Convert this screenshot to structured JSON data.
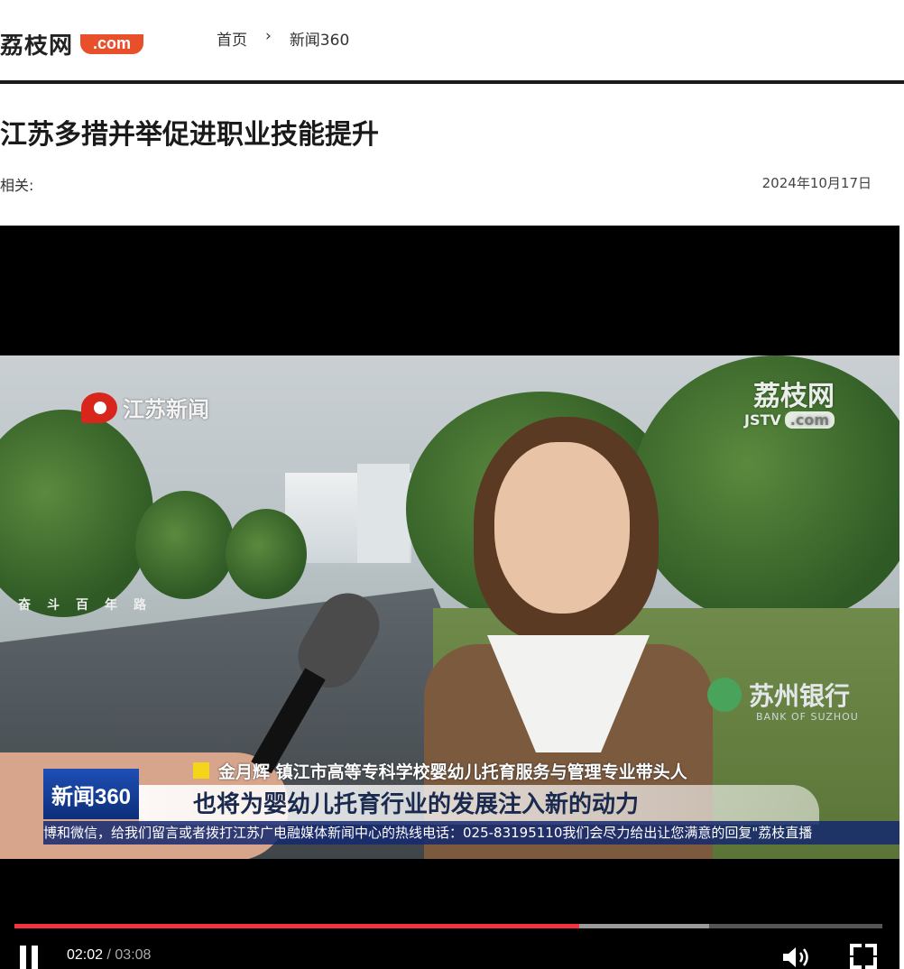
{
  "header": {
    "logo_text": "荔枝网",
    "logo_badge": ".com",
    "breadcrumb": [
      "首页",
      "›",
      "新闻360"
    ]
  },
  "article": {
    "title": "江苏多措并举促进职业技能提升",
    "related_label": "相关:",
    "date": "2024年10月17日"
  },
  "video": {
    "station_logo": "江苏新闻",
    "road_sign": "奋斗百年路",
    "watermark": {
      "main": "荔枝网",
      "sub": "JSTV",
      "badge": ".com"
    },
    "sponsor": {
      "cn": "苏州银行",
      "en": "BANK OF SUZHOU"
    },
    "program_logo": "新闻360",
    "speaker_caption": "金月辉 镇江市高等专科学校婴幼儿托育服务与管理专业带头人",
    "quote": "也将为婴幼儿托育行业的发展注入新的动力",
    "ticker": "博和微信，给我们留言或者拨打江苏广电融媒体新闻中心的热线电话：025-83195110我们会尽力给出让您满意的回复\"荔枝直播",
    "progress": {
      "played_fraction": 0.6509,
      "buffered_fraction": 0.8,
      "current": "02:02",
      "separator": " / ",
      "total": "03:08"
    },
    "colors": {
      "progress_played": "#f4323f",
      "progress_buffer": "#9a9a9a",
      "player_bg": "#000000"
    },
    "icons": [
      "pause-icon",
      "volume-icon",
      "fullscreen-icon"
    ]
  }
}
